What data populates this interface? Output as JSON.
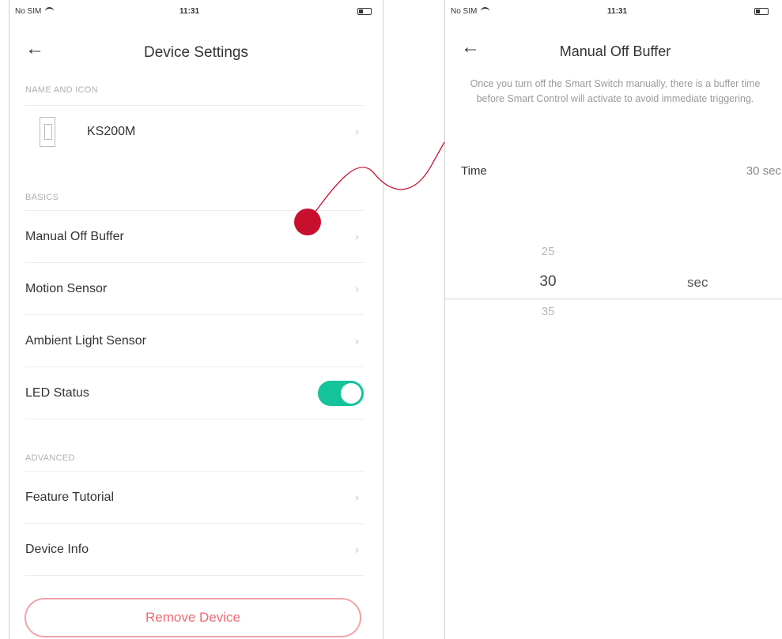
{
  "left_screen": {
    "status": {
      "carrier": "No SIM",
      "time": "11:31"
    },
    "nav": {
      "title": "Device Settings"
    },
    "sections": {
      "name_icon": "NAME AND ICON",
      "basics": "BASICS",
      "advanced": "ADVANCED"
    },
    "device": {
      "name": "KS200M"
    },
    "basics_items": [
      "Manual Off Buffer",
      "Motion Sensor",
      "Ambient Light Sensor"
    ],
    "led": {
      "label": "LED Status",
      "enabled": true
    },
    "advanced_items": [
      "Feature Tutorial",
      "Device Info"
    ],
    "remove_label": "Remove Device"
  },
  "right_screen": {
    "status": {
      "carrier": "No SIM",
      "time": "11:31"
    },
    "nav": {
      "title": "Manual Off Buffer"
    },
    "description": "Once you turn off the Smart Switch manually, there is a buffer time before Smart Control will activate to avoid immediate triggering.",
    "time_row": {
      "label": "Time",
      "value": "30 sec"
    },
    "picker": {
      "above": "25",
      "selected": "30",
      "below": "35",
      "unit": "sec"
    }
  },
  "colors": {
    "accent": "#15c39a",
    "remove": "#f06a73",
    "annotation": "#c8102e"
  },
  "icons": [
    "back-arrow-icon",
    "chevron-right-icon",
    "wifi-icon",
    "battery-icon",
    "switch-device-icon"
  ]
}
